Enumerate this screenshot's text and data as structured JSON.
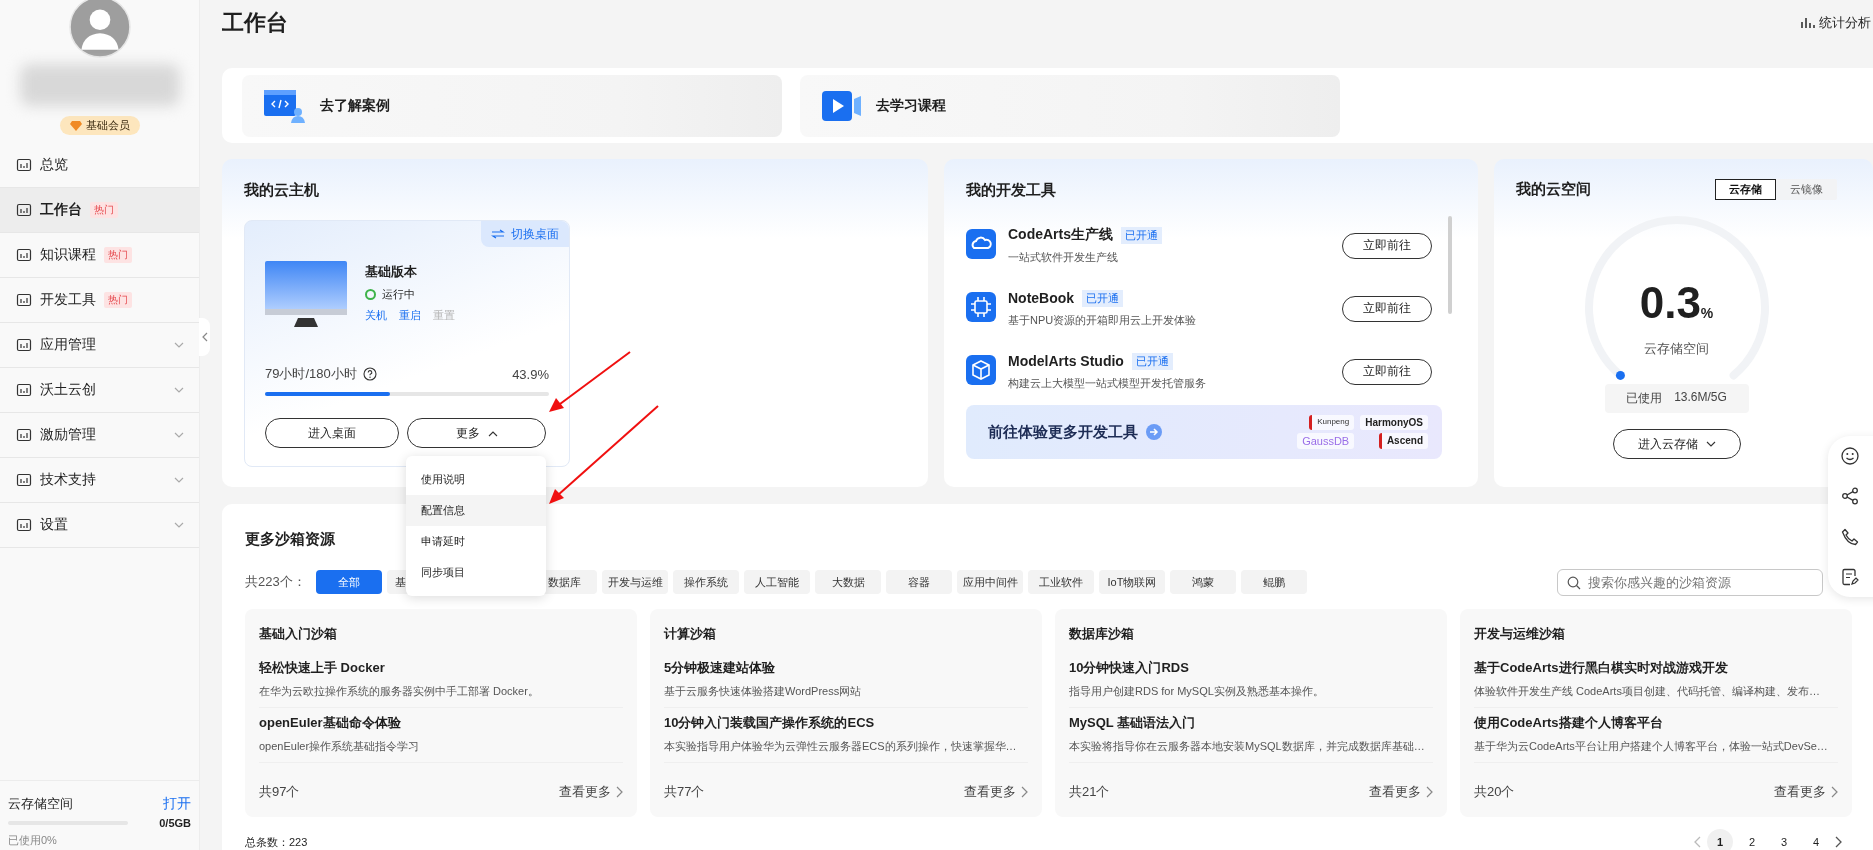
{
  "sidebar": {
    "badge": "基础会员",
    "nav": [
      {
        "label": "总览",
        "hot": false,
        "expandable": false,
        "selected": false
      },
      {
        "label": "工作台",
        "hot": true,
        "hot_label": "热门",
        "expandable": false,
        "selected": true
      },
      {
        "label": "知识课程",
        "hot": true,
        "hot_label": "热门",
        "expandable": false,
        "selected": false
      },
      {
        "label": "开发工具",
        "hot": true,
        "hot_label": "热门",
        "expandable": false,
        "selected": false
      },
      {
        "label": "应用管理",
        "hot": false,
        "expandable": true,
        "selected": false
      },
      {
        "label": "沃土云创",
        "hot": false,
        "expandable": true,
        "selected": false
      },
      {
        "label": "激励管理",
        "hot": false,
        "expandable": true,
        "selected": false
      },
      {
        "label": "技术支持",
        "hot": false,
        "expandable": true,
        "selected": false
      },
      {
        "label": "设置",
        "hot": false,
        "expandable": true,
        "selected": false
      }
    ],
    "storage": {
      "title": "云存储空间",
      "action": "打开",
      "amount": "0/5GB",
      "used": "已使用0%"
    }
  },
  "header": {
    "title": "工作台",
    "action": "统计分析"
  },
  "shortcuts": [
    {
      "label": "去了解案例"
    },
    {
      "label": "去学习课程"
    }
  ],
  "host": {
    "title": "我的云主机",
    "switch": "切换桌面",
    "name": "基础版本",
    "status": "运行中",
    "running": true,
    "actions": [
      {
        "label": "关机",
        "disabled": false
      },
      {
        "label": "重启",
        "disabled": false
      },
      {
        "label": "重置",
        "disabled": true
      }
    ],
    "usage": "79小时/180小时",
    "percent": "43.9%",
    "level": 0.439,
    "enter": "进入桌面",
    "more": "更多",
    "menu_open": true,
    "menu": [
      {
        "label": "使用说明",
        "highlighted": false
      },
      {
        "label": "配置信息",
        "highlighted": true
      },
      {
        "label": "申请延时",
        "highlighted": false
      },
      {
        "label": "同步项目",
        "highlighted": false
      }
    ]
  },
  "devtools": {
    "title": "我的开发工具",
    "tools": [
      {
        "name": "CodeArts生产线",
        "badge": "已开通",
        "desc": "一站式软件开发生产线",
        "action": "立即前往"
      },
      {
        "name": "NoteBook",
        "badge": "已开通",
        "desc": "基于NPU资源的开箱即用云上开发体验",
        "action": "立即前往"
      },
      {
        "name": "ModelArts Studio",
        "badge": "已开通",
        "desc": "构建云上大模型一站式模型开发托管服务",
        "action": "立即前往"
      }
    ],
    "promo": {
      "title": "前往体验更多开发工具",
      "logos": [
        "Kunpeng",
        "HarmonyOS",
        "GaussDB",
        "Ascend"
      ]
    }
  },
  "cloud_space": {
    "title": "我的云空间",
    "tabs": [
      {
        "label": "云存储",
        "selected": true
      },
      {
        "label": "云镜像",
        "selected": false
      }
    ],
    "value": "0.3",
    "unit": "%",
    "caption": "云存储空间",
    "used_label": "已使用",
    "used_value": "13.6M/5G",
    "button": "进入云存储"
  },
  "sandbox": {
    "title": "更多沙箱资源",
    "total": "共223个：",
    "tabs": [
      {
        "label": "全部",
        "selected": true,
        "covered": false
      },
      {
        "label": "基",
        "selected": false,
        "covered": true
      },
      {
        "label": "数据库",
        "selected": false,
        "covered": false
      },
      {
        "label": "开发与运维",
        "selected": false,
        "covered": false
      },
      {
        "label": "操作系统",
        "selected": false,
        "covered": false
      },
      {
        "label": "人工智能",
        "selected": false,
        "covered": false
      },
      {
        "label": "大数据",
        "selected": false,
        "covered": false
      },
      {
        "label": "容器",
        "selected": false,
        "covered": false
      },
      {
        "label": "应用中间件",
        "selected": false,
        "covered": false
      },
      {
        "label": "工业软件",
        "selected": false,
        "covered": false
      },
      {
        "label": "IoT物联网",
        "selected": false,
        "covered": false
      },
      {
        "label": "鸿蒙",
        "selected": false,
        "covered": false
      },
      {
        "label": "鲲鹏",
        "selected": false,
        "covered": false
      }
    ],
    "search": {
      "placeholder": "搜索你感兴趣的沙箱资源"
    },
    "cards": [
      {
        "title": "基础入门沙箱",
        "items": [
          {
            "title": "轻松快速上手 Docker",
            "desc": "在华为云欧拉操作系统的服务器实例中手工部署 Docker。"
          },
          {
            "title": "openEuler基础命令体验",
            "desc": "openEuler操作系统基础指令学习"
          }
        ],
        "count": "共97个",
        "more": "查看更多"
      },
      {
        "title": "计算沙箱",
        "items": [
          {
            "title": "5分钟极速建站体验",
            "desc": "基于云服务快速体验搭建WordPress网站"
          },
          {
            "title": "10分钟入门装载国产操作系统的ECS",
            "desc": "本实验指导用户体验华为云弹性云服务器ECS的系列操作，快速掌握华…"
          }
        ],
        "count": "共77个",
        "more": "查看更多"
      },
      {
        "title": "数据库沙箱",
        "items": [
          {
            "title": "10分钟快速入门RDS",
            "desc": "指导用户创建RDS for MySQL实例及熟悉基本操作。"
          },
          {
            "title": "MySQL 基础语法入门",
            "desc": "本实验将指导你在云服务器本地安装MySQL数据库，并完成数据库基础…"
          }
        ],
        "count": "共21个",
        "more": "查看更多"
      },
      {
        "title": "开发与运维沙箱",
        "items": [
          {
            "title": "基于CodeArts进行黑白棋实时对战游戏开发",
            "desc": "体验软件开发生产线 CodeArts项目创建、代码托管、编译构建、发布…"
          },
          {
            "title": "使用CodeArts搭建个人博客平台",
            "desc": "基于华为云CodeArts平台让用户搭建个人博客平台，体验一站式DevSe…"
          }
        ],
        "count": "共20个",
        "more": "查看更多"
      }
    ],
    "footer_total": "总条数：223",
    "pages": [
      {
        "label": "1",
        "selected": true
      },
      {
        "label": "2",
        "selected": false
      },
      {
        "label": "3",
        "selected": false
      },
      {
        "label": "4",
        "selected": false
      }
    ]
  }
}
